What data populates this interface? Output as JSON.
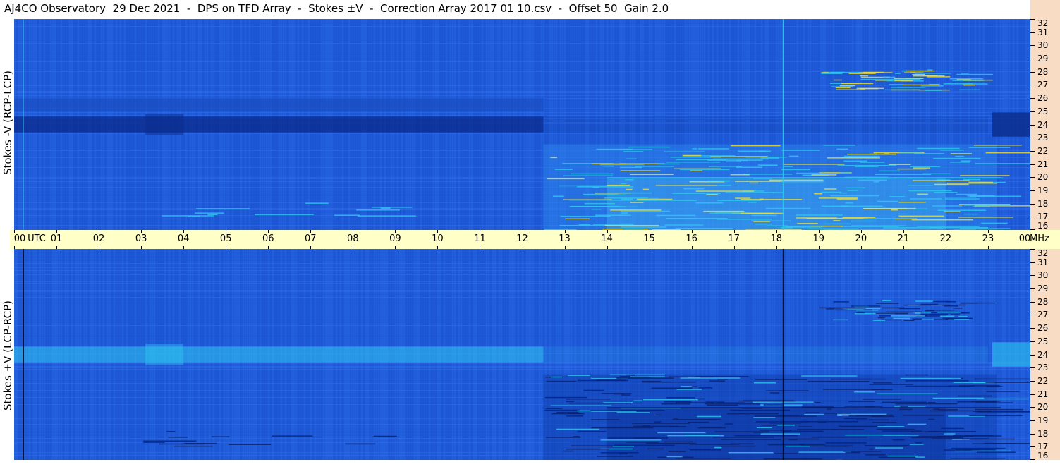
{
  "title": "AJ4CO Observatory  29 Dec 2021  -  DPS on TFD Array  -  Stokes ±V  -  Correction Array 2017 01 10.csv  -  Offset 50  Gain 2.0",
  "panels": {
    "top_label": "Stokes -V (RCP-LCP)",
    "bottom_label": "Stokes +V (LCP-RCP)"
  },
  "colors": {
    "background_blue": "#1e5ad8",
    "dark_blue": "#0a2a8a",
    "cyan": "#2fc8f0",
    "yellow": "#f0e030",
    "axis_band": "#ffffc8",
    "freq_band": "#f9dcc4"
  },
  "chart_data": {
    "type": "heatmap",
    "x_unit": "UTC",
    "y_unit": "MHz",
    "x_ticks": [
      "00",
      "01",
      "02",
      "03",
      "04",
      "05",
      "06",
      "07",
      "08",
      "09",
      "10",
      "11",
      "12",
      "13",
      "14",
      "15",
      "16",
      "17",
      "18",
      "19",
      "20",
      "21",
      "22",
      "23",
      "00"
    ],
    "x_range_hours": [
      0,
      24
    ],
    "y_ticks": [
      "16",
      "17",
      "18",
      "19",
      "20",
      "21",
      "22",
      "23",
      "24",
      "25",
      "26",
      "27",
      "28",
      "29",
      "30",
      "31",
      "32"
    ],
    "y_range_mhz": [
      16,
      32
    ],
    "x_axis_labels": {
      "utc": "UTC",
      "mhz": "MHz"
    },
    "panels": [
      {
        "name": "Stokes -V (RCP-LCP)",
        "position": "top"
      },
      {
        "name": "Stokes +V (LCP-RCP)",
        "position": "bottom"
      }
    ]
  }
}
